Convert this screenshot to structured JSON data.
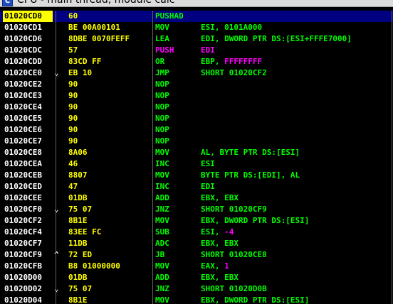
{
  "window": {
    "title": "CPU - main thread, module calc"
  },
  "selected_index": 0,
  "colors": {
    "bg": "#000000",
    "address": "#ffffff",
    "hex": "#ffff00",
    "instr": "#00ff00",
    "push": "#ff00ff",
    "selection": "#000080"
  },
  "rows": [
    {
      "addr": "01020CD0",
      "mark": "",
      "hex": "60",
      "mnem": "PUSHAD",
      "ops": ""
    },
    {
      "addr": "01020CD1",
      "mark": "",
      "hex": "BE 00A00101",
      "mnem": "MOV",
      "ops": "ESI, 0101A000"
    },
    {
      "addr": "01020CD6",
      "mark": "",
      "hex": "8DBE 0070FEFF",
      "mnem": "LEA",
      "ops": "EDI, DWORD PTR DS:[ESI+FFFE7000]"
    },
    {
      "addr": "01020CDC",
      "mark": "",
      "hex": "57",
      "mnem": "PUSH",
      "ops": "EDI",
      "color": "push"
    },
    {
      "addr": "01020CDD",
      "mark": "",
      "hex": "83CD FF",
      "mnem": "OR",
      "ops": "EBP, FFFFFFFF",
      "ops_hl": "FFFFFFFF"
    },
    {
      "addr": "01020CE0",
      "mark": "⌄",
      "hex": "EB 10",
      "mnem": "JMP",
      "ops": "SHORT 01020CF2"
    },
    {
      "addr": "01020CE2",
      "mark": "",
      "hex": "90",
      "mnem": "NOP",
      "ops": ""
    },
    {
      "addr": "01020CE3",
      "mark": "",
      "hex": "90",
      "mnem": "NOP",
      "ops": ""
    },
    {
      "addr": "01020CE4",
      "mark": "",
      "hex": "90",
      "mnem": "NOP",
      "ops": ""
    },
    {
      "addr": "01020CE5",
      "mark": "",
      "hex": "90",
      "mnem": "NOP",
      "ops": ""
    },
    {
      "addr": "01020CE6",
      "mark": "",
      "hex": "90",
      "mnem": "NOP",
      "ops": ""
    },
    {
      "addr": "01020CE7",
      "mark": "",
      "hex": "90",
      "mnem": "NOP",
      "ops": ""
    },
    {
      "addr": "01020CE8",
      "mark": "",
      "hex": "8A06",
      "mnem": "MOV",
      "ops": "AL, BYTE PTR DS:[ESI]"
    },
    {
      "addr": "01020CEA",
      "mark": "",
      "hex": "46",
      "mnem": "INC",
      "ops": "ESI"
    },
    {
      "addr": "01020CEB",
      "mark": "",
      "hex": "8807",
      "mnem": "MOV",
      "ops": "BYTE PTR DS:[EDI], AL"
    },
    {
      "addr": "01020CED",
      "mark": "",
      "hex": "47",
      "mnem": "INC",
      "ops": "EDI"
    },
    {
      "addr": "01020CEE",
      "mark": "",
      "hex": "01DB",
      "mnem": "ADD",
      "ops": "EBX, EBX"
    },
    {
      "addr": "01020CF0",
      "mark": "⌄",
      "hex": "75 07",
      "mnem": "JNZ",
      "ops": "SHORT 01020CF9"
    },
    {
      "addr": "01020CF2",
      "mark": "",
      "hex": "8B1E",
      "mnem": "MOV",
      "ops": "EBX, DWORD PTR DS:[ESI]"
    },
    {
      "addr": "01020CF4",
      "mark": "",
      "hex": "83EE FC",
      "mnem": "SUB",
      "ops": "ESI, -4",
      "ops_hl": "-4"
    },
    {
      "addr": "01020CF7",
      "mark": "",
      "hex": "11DB",
      "mnem": "ADC",
      "ops": "EBX, EBX"
    },
    {
      "addr": "01020CF9",
      "mark": "^",
      "hex": "72 ED",
      "mnem": "JB",
      "ops": "SHORT 01020CE8"
    },
    {
      "addr": "01020CFB",
      "mark": "",
      "hex": "B8 01000000",
      "mnem": "MOV",
      "ops": "EAX, 1",
      "ops_hl": "1"
    },
    {
      "addr": "01020D00",
      "mark": "",
      "hex": "01DB",
      "mnem": "ADD",
      "ops": "EBX, EBX"
    },
    {
      "addr": "01020D02",
      "mark": "⌄",
      "hex": "75 07",
      "mnem": "JNZ",
      "ops": "SHORT 01020D0B"
    },
    {
      "addr": "01020D04",
      "mark": "",
      "hex": "8B1E",
      "mnem": "MOV",
      "ops": "EBX, DWORD PTR DS:[ESI]"
    }
  ]
}
